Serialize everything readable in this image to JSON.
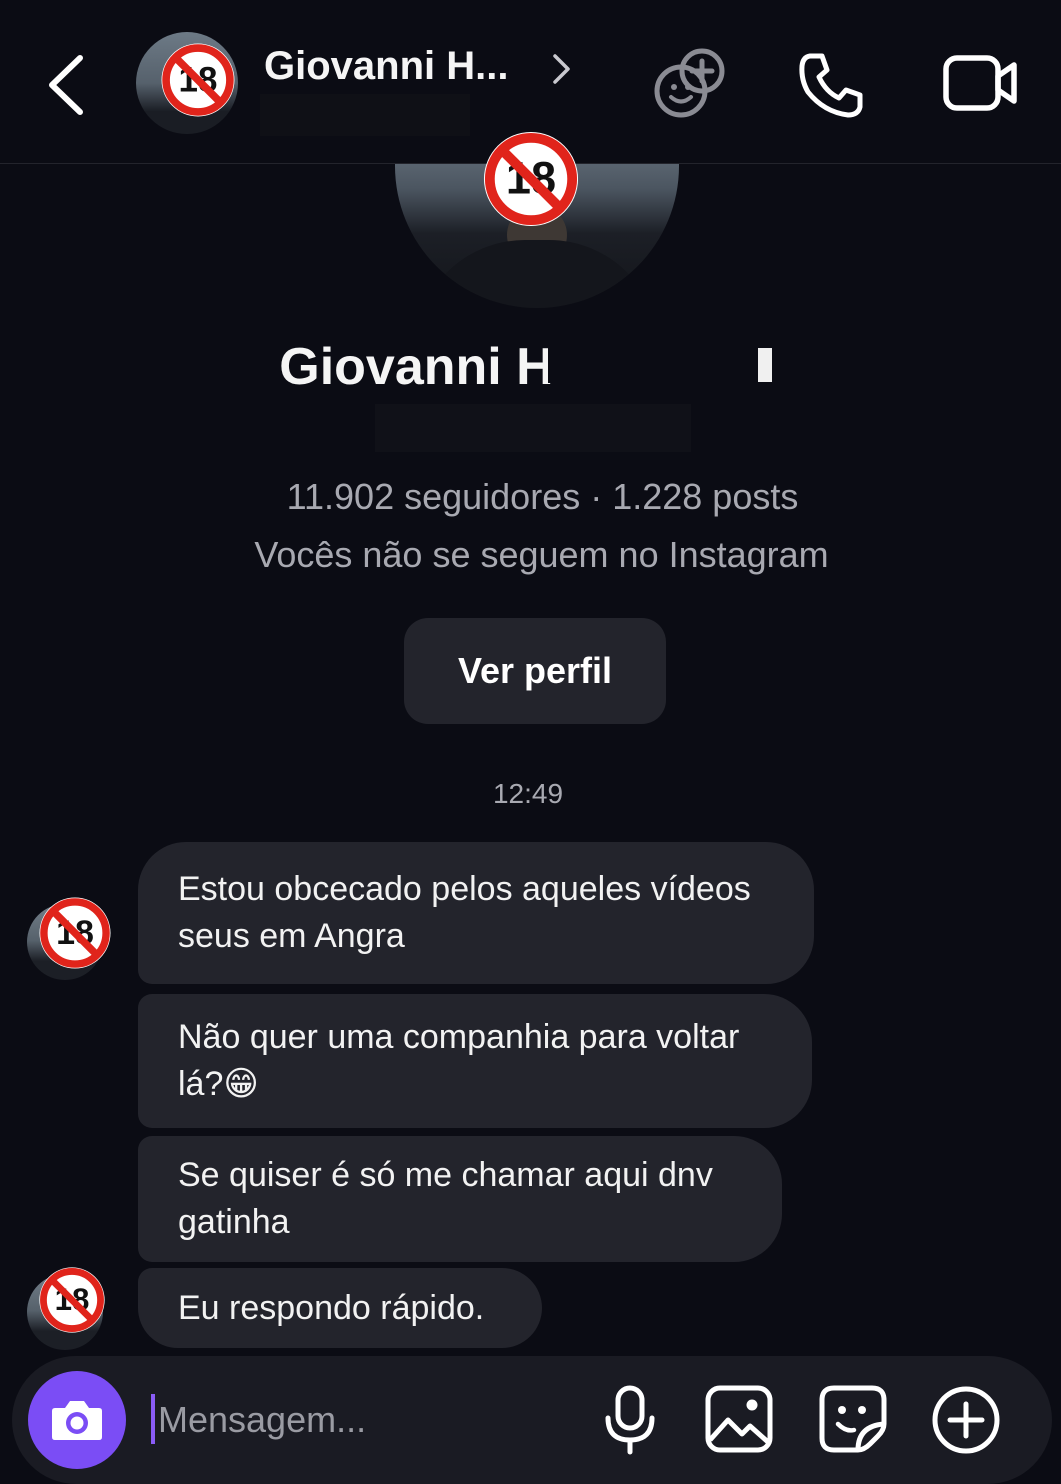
{
  "header": {
    "name": "Giovanni H...",
    "icons": {
      "back": "chevron-left-icon",
      "forward": "chevron-right-icon",
      "effects": "face-effects-icon",
      "call": "phone-icon",
      "video": "video-camera-icon"
    }
  },
  "profile": {
    "name": "Giovanni H",
    "followers_posts": "11.902 seguidores · 1.228 posts",
    "mutual_text": "Vocês não se seguem no Instagram",
    "view_profile_label": "Ver perfil",
    "age_badge": "18"
  },
  "conversation": {
    "timestamp": "12:49",
    "messages": [
      {
        "text": "Estou obcecado pelos aqueles vídeos seus em Angra"
      },
      {
        "text": "Não quer uma companhia para voltar lá?😁"
      },
      {
        "text": "Se quiser é só me chamar aqui dnv gatinha"
      },
      {
        "text": "Eu respondo rápido."
      }
    ]
  },
  "composer": {
    "placeholder": "Mensagem...",
    "value": "",
    "icons": [
      "camera-icon",
      "microphone-icon",
      "image-icon",
      "sticker-icon",
      "plus-circle-icon"
    ]
  },
  "colors": {
    "background": "#0b0c14",
    "bubble": "#23242c",
    "accent": "#7b4df5",
    "secondary_text": "#a8a9b1"
  }
}
